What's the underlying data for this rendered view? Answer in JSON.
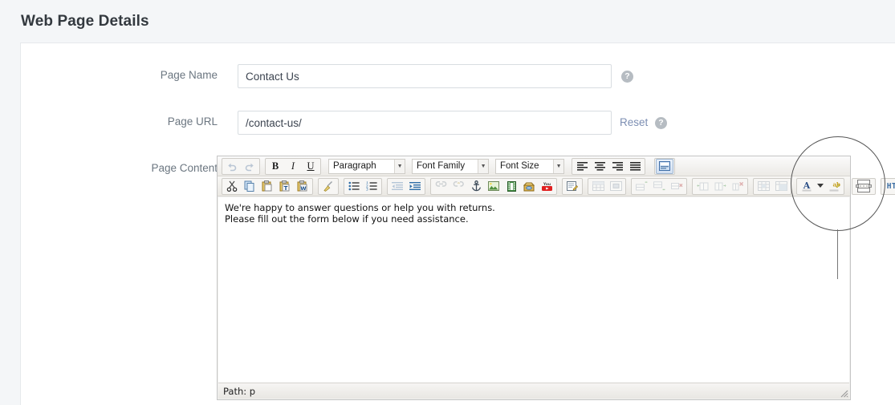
{
  "page": {
    "title": "Web Page Details"
  },
  "form": {
    "rows": [
      {
        "label": "Page Name",
        "value": "Contact Us",
        "help": "?"
      },
      {
        "label": "Page URL",
        "value": "/contact-us/",
        "help": "?",
        "reset_label": "Reset"
      },
      {
        "label": "Page Content"
      }
    ]
  },
  "editor": {
    "toolbar_row1": {
      "undo": "undo-icon",
      "redo": "redo-icon",
      "bold": "B",
      "italic": "I",
      "underline": "U",
      "format_select": "Paragraph",
      "fontfamily_select": "Font Family",
      "fontsize_select": "Font Size",
      "align_left": "align-left-icon",
      "align_center": "align-center-icon",
      "align_right": "align-right-icon",
      "align_justify": "align-justify-icon",
      "styleprops": "style-props-icon"
    },
    "toolbar_row2": {
      "cut": "cut-icon",
      "copy": "copy-icon",
      "paste": "paste-icon",
      "paste_text": "paste-as-text-icon",
      "paste_word": "paste-from-word-icon",
      "cleanup": "cleanup-broom-icon",
      "bullist": "bullet-list-icon",
      "numlist": "numbered-list-icon",
      "outdent": "outdent-icon",
      "indent": "indent-icon",
      "link": "link-icon",
      "unlink": "unlink-icon",
      "anchor": "anchor-icon",
      "image": "image-icon",
      "media": "media-film-icon",
      "package": "package-icon",
      "youtube": "youtube-icon",
      "edit_source": "edit-source-icon",
      "table": "table-icon",
      "table_props": "table-properties-icon",
      "row_before": "row-before-icon",
      "row_after": "row-after-icon",
      "row_delete": "row-delete-icon",
      "col_before": "col-before-icon",
      "col_after": "col-after-icon",
      "col_delete": "col-delete-icon",
      "split_cells": "split-cells-icon",
      "merge_cells": "merge-cells-icon",
      "forecolor": "text-color-icon",
      "forecolor_arrow": "chevron-down-icon",
      "backcolor": "background-color-icon",
      "pagebreak": "page-break-icon",
      "html": "HTML"
    },
    "content_lines": [
      "We're happy to answer questions or help you with returns.",
      "Please fill out the form below if you need assistance."
    ],
    "statusbar": "Path: p",
    "resize_grip": "resize-grip-icon"
  },
  "annotation": {
    "highlight": "html-button-highlight-circle"
  },
  "colors": {
    "page_bg": "#f4f6f8",
    "card_bg": "#ffffff",
    "title": "#33393f",
    "label": "#6b7680",
    "input_border": "#d8dde1",
    "link": "#7d8fb3",
    "help_bg": "#b6bcc2",
    "toolbar_border": "#c5c5c5"
  }
}
